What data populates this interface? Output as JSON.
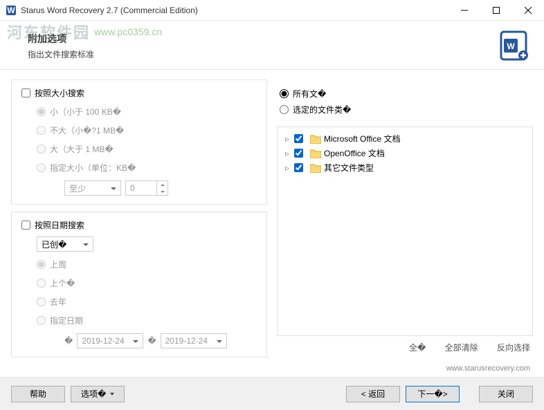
{
  "window": {
    "title": "Starus Word Recovery 2.7 (Commercial Edition)"
  },
  "watermark": {
    "logo": "河东软件园",
    "url": "www.pc0359.cn"
  },
  "header": {
    "title": "附加选项",
    "subtitle": "指出文件搜索标准"
  },
  "size_search": {
    "enable_label": "按照大小搜索",
    "small": "小（小于 100 KB�",
    "medium": "不大（小�?1 MB�",
    "large": "大（大于 1 MB�",
    "custom": "指定大小（单位：KB�",
    "mode_value": "至少",
    "size_value": "0"
  },
  "date_search": {
    "enable_label": "按照日期搜索",
    "type_value": "已创�",
    "last_week": "上周",
    "last_month": "上个�",
    "last_year": "去年",
    "custom": "指定日期",
    "from_date": "2019-12-24",
    "to_date": "2019-12-24"
  },
  "filetype": {
    "all_label": "所有文�",
    "selected_label": "选定的文件类�",
    "items": {
      "ms": "Microsoft Office 文档",
      "oo": "OpenOffice 文档",
      "other": "其它文件类型"
    }
  },
  "links": {
    "all": "全�",
    "clear": "全部清除",
    "invert": "反向选择"
  },
  "footer": {
    "url": "www.starusrecovery.com",
    "help": "帮助",
    "options": "选项�",
    "back": "< 返回",
    "next": "下一�>",
    "close": "关闭"
  }
}
